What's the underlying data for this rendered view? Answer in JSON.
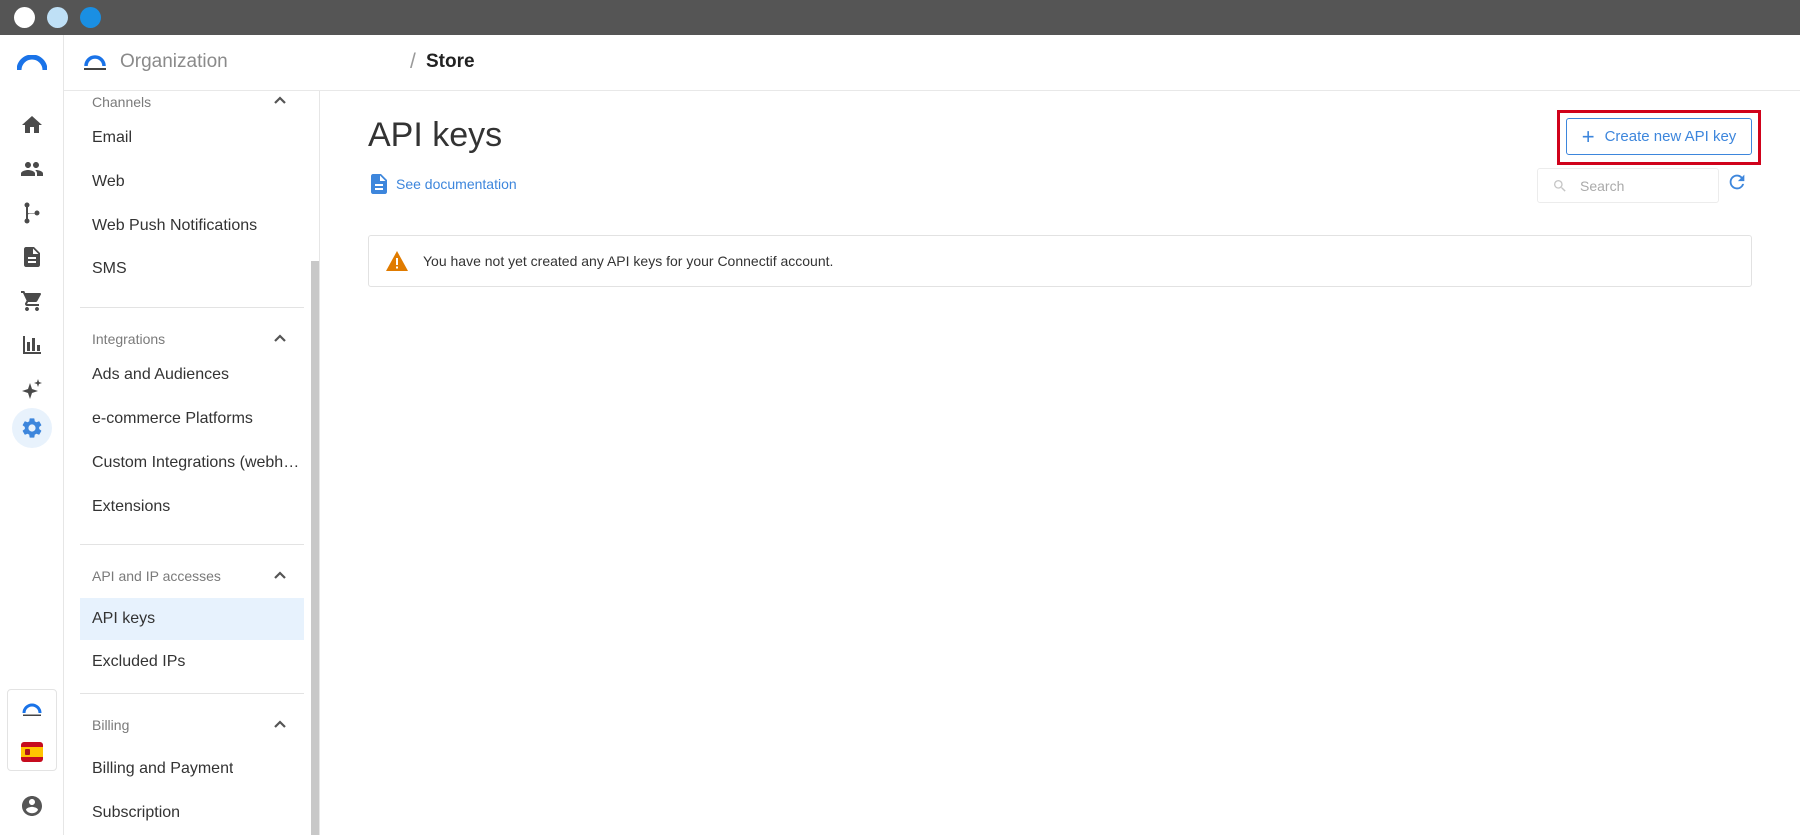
{
  "header": {
    "org_name": "Organization",
    "breadcrumb_separator": "/",
    "store": "Store"
  },
  "rail": {
    "items": [
      {
        "icon": "home-icon"
      },
      {
        "icon": "contacts-icon"
      },
      {
        "icon": "workflow-icon"
      },
      {
        "icon": "content-icon"
      },
      {
        "icon": "store-cart-icon"
      },
      {
        "icon": "reports-icon"
      },
      {
        "icon": "ai-sparkles-icon"
      },
      {
        "icon": "settings-gear-icon",
        "active": true
      }
    ]
  },
  "sidebar": {
    "sections": [
      {
        "title": "Channels",
        "items": [
          "Email",
          "Web",
          "Web Push Notifications",
          "SMS"
        ]
      },
      {
        "title": "Integrations",
        "items": [
          "Ads and Audiences",
          "e-commerce Platforms",
          "Custom Integrations (webhooks)",
          "Extensions"
        ]
      },
      {
        "title": "API and IP accesses",
        "items": [
          "API keys",
          "Excluded IPs"
        ]
      },
      {
        "title": "Billing",
        "items": [
          "Billing and Payment",
          "Subscription"
        ]
      }
    ],
    "active_item": "API keys"
  },
  "main": {
    "title": "API keys",
    "doc_link": "See documentation",
    "create_button": "Create new API key",
    "search_placeholder": "Search",
    "alert_message": "You have not yet created any API keys for your Connectif account."
  },
  "colors": {
    "accent": "#3d86dc",
    "highlight": "#d0021b",
    "warning": "#e07b00",
    "active_bg": "#e7f2fd"
  }
}
